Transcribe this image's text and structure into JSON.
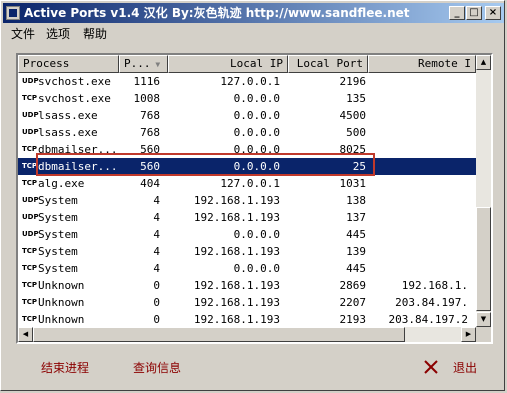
{
  "window": {
    "title": "Active Ports v1.4 汉化 By:灰色轨迹 http://www.sandflee.net"
  },
  "menu": [
    "文件",
    "选项",
    "帮助"
  ],
  "columns": [
    {
      "label": "Process"
    },
    {
      "label": "P..."
    },
    {
      "label": "Local IP"
    },
    {
      "label": "Local Port"
    },
    {
      "label": "Remote I"
    }
  ],
  "rows": [
    {
      "proto": "UDP",
      "process": "svchost.exe",
      "pid": "1116",
      "local_ip": "127.0.0.1",
      "local_port": "2196",
      "remote": ""
    },
    {
      "proto": "TCP",
      "process": "svchost.exe",
      "pid": "1008",
      "local_ip": "0.0.0.0",
      "local_port": "135",
      "remote": ""
    },
    {
      "proto": "UDP",
      "process": "lsass.exe",
      "pid": "768",
      "local_ip": "0.0.0.0",
      "local_port": "4500",
      "remote": ""
    },
    {
      "proto": "UDP",
      "process": "lsass.exe",
      "pid": "768",
      "local_ip": "0.0.0.0",
      "local_port": "500",
      "remote": ""
    },
    {
      "proto": "TCP",
      "process": "dbmailser...",
      "pid": "560",
      "local_ip": "0.0.0.0",
      "local_port": "8025",
      "remote": ""
    },
    {
      "proto": "TCP",
      "process": "dbmailser...",
      "pid": "560",
      "local_ip": "0.0.0.0",
      "local_port": "25",
      "remote": "",
      "selected": true
    },
    {
      "proto": "TCP",
      "process": "alg.exe",
      "pid": "404",
      "local_ip": "127.0.0.1",
      "local_port": "1031",
      "remote": ""
    },
    {
      "proto": "UDP",
      "process": "System",
      "pid": "4",
      "local_ip": "192.168.1.193",
      "local_port": "138",
      "remote": ""
    },
    {
      "proto": "UDP",
      "process": "System",
      "pid": "4",
      "local_ip": "192.168.1.193",
      "local_port": "137",
      "remote": ""
    },
    {
      "proto": "UDP",
      "process": "System",
      "pid": "4",
      "local_ip": "0.0.0.0",
      "local_port": "445",
      "remote": ""
    },
    {
      "proto": "TCP",
      "process": "System",
      "pid": "4",
      "local_ip": "192.168.1.193",
      "local_port": "139",
      "remote": ""
    },
    {
      "proto": "TCP",
      "process": "System",
      "pid": "4",
      "local_ip": "0.0.0.0",
      "local_port": "445",
      "remote": ""
    },
    {
      "proto": "TCP",
      "process": "Unknown",
      "pid": "0",
      "local_ip": "192.168.1.193",
      "local_port": "2869",
      "remote": "192.168.1."
    },
    {
      "proto": "TCP",
      "process": "Unknown",
      "pid": "0",
      "local_ip": "192.168.1.193",
      "local_port": "2207",
      "remote": "203.84.197."
    },
    {
      "proto": "TCP",
      "process": "Unknown",
      "pid": "0",
      "local_ip": "192.168.1.193",
      "local_port": "2193",
      "remote": "203.84.197.2"
    }
  ],
  "buttons": {
    "end_process": "结束进程",
    "query_info": "查询信息",
    "exit": "退出"
  },
  "colors": {
    "selection": "#0a246a",
    "highlight_box": "#c0392b",
    "button_text": "#8b0000"
  }
}
